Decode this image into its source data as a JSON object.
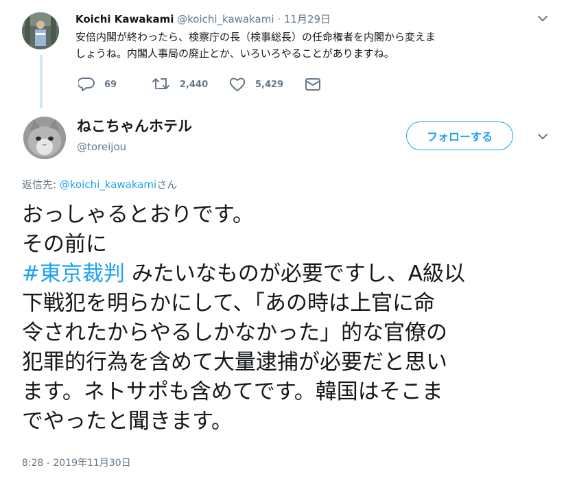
{
  "reply_tweet": {
    "name": "Koichi Kawakami",
    "handle": "@koichi_kawakami",
    "separator": "·",
    "date": "11月29日",
    "text_line1": "安倍内閣が終わったら、検察庁の長（検事総長）の任命権者を内閣から変えま",
    "text_line2": "しょうね。内閣人事局の廃止とか、いろいろやることがありますね。",
    "stats": {
      "replies": "69",
      "retweets": "2,440",
      "likes": "5,429"
    },
    "icons": [
      "reply-icon",
      "retweet-icon",
      "like-icon",
      "dm-icon",
      "chevron-down-icon"
    ]
  },
  "main_tweet": {
    "name": "ねこちゃんホテル",
    "handle": "@toreijou",
    "follow_label": "フォローする",
    "reply_prefix": "返信先: ",
    "reply_mention": "@koichi_kawakami",
    "reply_suffix": "さん",
    "body": {
      "line1": "おっしゃるとおりです。",
      "line2": "その前に",
      "hashtag": "#東京裁判",
      "line3_rest": " みたいなものが必要ですし、A級以",
      "line4": "下戦犯を明らかにして、「あの時は上官に命",
      "line5": "令されたからやるしかなかった」的な官僚の",
      "line6": "犯罪的行為を含めて大量逮捕が必要だと思い",
      "line7": "ます。ネトサポも含めてです。韓国はそこま",
      "line8": "でやったと聞きます。"
    },
    "timestamp": "8:28 - 2019年11月30日"
  },
  "colors": {
    "accent": "#1da1f2",
    "text": "#14171a",
    "secondary": "#657786",
    "thread_line": "#cce6ff"
  }
}
